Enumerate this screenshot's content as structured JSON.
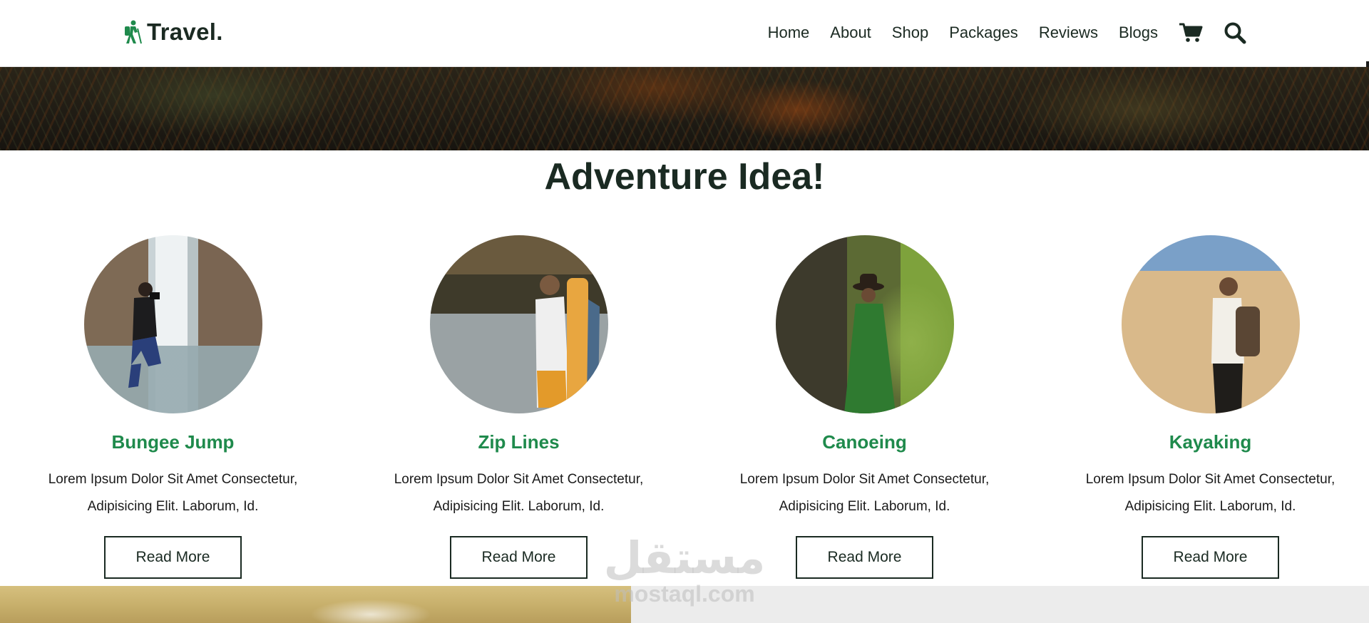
{
  "header": {
    "logo_text": "Travel.",
    "nav": [
      "Home",
      "About",
      "Shop",
      "Packages",
      "Reviews",
      "Blogs"
    ],
    "icons": [
      "cart-icon",
      "search-icon"
    ]
  },
  "section": {
    "title": "Adventure Idea!"
  },
  "cards": [
    {
      "title": "Bungee Jump",
      "text": "Lorem Ipsum Dolor Sit Amet Consectetur, Adipisicing Elit. Laborum, Id.",
      "button": "Read More"
    },
    {
      "title": "Zip Lines",
      "text": "Lorem Ipsum Dolor Sit Amet Consectetur, Adipisicing Elit. Laborum, Id.",
      "button": "Read More"
    },
    {
      "title": "Canoeing",
      "text": "Lorem Ipsum Dolor Sit Amet Consectetur, Adipisicing Elit. Laborum, Id.",
      "button": "Read More"
    },
    {
      "title": "Kayaking",
      "text": "Lorem Ipsum Dolor Sit Amet Consectetur, Adipisicing Elit. Laborum, Id.",
      "button": "Read More"
    }
  ],
  "watermark": {
    "arabic": "مستقل",
    "latin": "mostaql.com"
  },
  "colors": {
    "accent": "#1f8a4c",
    "text_dark": "#1a2a22"
  }
}
